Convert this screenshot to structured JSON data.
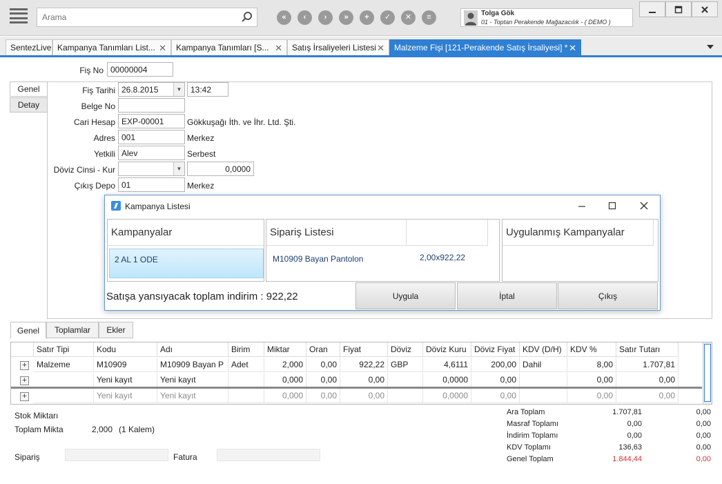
{
  "topbar": {
    "search_placeholder": "Arama",
    "nav_buttons": [
      "«",
      "‹",
      "›",
      "»",
      "+",
      "✓",
      "✕",
      "≡"
    ],
    "user_name": "Tolga Gök",
    "user_company": "01 - Toptan Perakende Mağazacılık - ( DEMO )"
  },
  "tabs": [
    {
      "label": "SentezLive"
    },
    {
      "label": "Kampanya Tanımları List..."
    },
    {
      "label": "Kampanya Tanımları  [S..."
    },
    {
      "label": "Satış İrsaliyeleri Listesi"
    },
    {
      "label": "Malzeme Fişi  [121-Perakende Satış İrsaliyesi] *"
    }
  ],
  "form": {
    "fis_no_label": "Fiş No",
    "fis_no": "00000004",
    "side_tabs": [
      "Genel",
      "Detay"
    ],
    "fis_tarihi_label": "Fiş Tarihi",
    "fis_tarihi": "26.8.2015",
    "fis_saat": "13:42",
    "belge_no_label": "Belge No",
    "belge_no": "",
    "cari_hesap_label": "Cari Hesap",
    "cari_hesap": "EXP-00001",
    "cari_hesap_name": "Gökkuşağı İth. ve İhr. Ltd. Şti.",
    "adres_label": "Adres",
    "adres": "001",
    "adres_name": "Merkez",
    "yetkili_label": "Yetkili",
    "yetkili": "Alev",
    "yetkili_desc": "Serbest",
    "doviz_label": "Döviz Cinsi - Kur",
    "doviz": "",
    "kur": "0,0000",
    "cikis_depo_label": "Çıkış Depo",
    "cikis_depo": "01",
    "cikis_depo_name": "Merkez"
  },
  "dialog": {
    "title": "Kampanya Listesi",
    "kampanyalar_header": "Kampanyalar",
    "kampanya_item": "2 AL 1 ODE",
    "siparis_header": "Sipariş Listesi",
    "siparis_item_name": "M10909 Bayan Pantolon",
    "siparis_item_qty": "2,00x922,22",
    "uygulanmis_header": "Uygulanmış Kampanyalar",
    "total_text": "Satışa yansıyacak toplam indirim : 922,22",
    "btn_uygula": "Uygula",
    "btn_iptal": "İptal",
    "btn_cikis": "Çıkış"
  },
  "bottom_tabs": [
    "Genel",
    "Toplamlar",
    "Ekler"
  ],
  "grid": {
    "columns": [
      "Satır Tipi",
      "Kodu",
      "Adı",
      "Birim",
      "Miktar",
      "Oran",
      "Fiyat",
      "Döviz",
      "Döviz Kuru",
      "Döviz Fiyat",
      "KDV (D/H)",
      "KDV %",
      "Satır Tutarı"
    ],
    "rows": [
      [
        "Malzeme",
        "M10909",
        "M10909 Bayan P",
        "Adet",
        "2,000",
        "0,00",
        "922,22",
        "GBP",
        "4,6111",
        "200,00",
        "Dahil",
        "8,00",
        "1.707,81"
      ],
      [
        "",
        "Yeni kayıt",
        "Yeni kayıt",
        "",
        "0,000",
        "0,00",
        "0,00",
        "",
        "0,0000",
        "0,00",
        "",
        "0,00",
        "0,00"
      ],
      [
        "",
        "Yeni kayıt",
        "Yeni kayıt",
        "",
        "0,000",
        "0,00",
        "0,00",
        "",
        "0,0000",
        "0,00",
        "",
        "0,00",
        "0,00"
      ]
    ]
  },
  "summary": {
    "stok_miktari_label": "Stok Miktarı",
    "toplam_miktar_label": "Toplam Mikta",
    "toplam_miktar_value": "2,000",
    "toplam_kalem": "(1 Kalem)",
    "siparis_label": "Sipariş",
    "fatura_label": "Fatura"
  },
  "totals": [
    {
      "label": "Ara Toplam",
      "v1": "1.707,81",
      "v2": "0,00"
    },
    {
      "label": "Masraf Toplamı",
      "v1": "0,00",
      "v2": "0,00"
    },
    {
      "label": "İndirim Toplamı",
      "v1": "0,00",
      "v2": "0,00"
    },
    {
      "label": "KDV Toplamı",
      "v1": "136,63",
      "v2": "0,00"
    },
    {
      "label": "Genel Toplam",
      "v1": "1.844,44",
      "v2": "0,00"
    }
  ],
  "colors": {
    "accent": "#2f7fd3",
    "total_red": "#e03030"
  }
}
